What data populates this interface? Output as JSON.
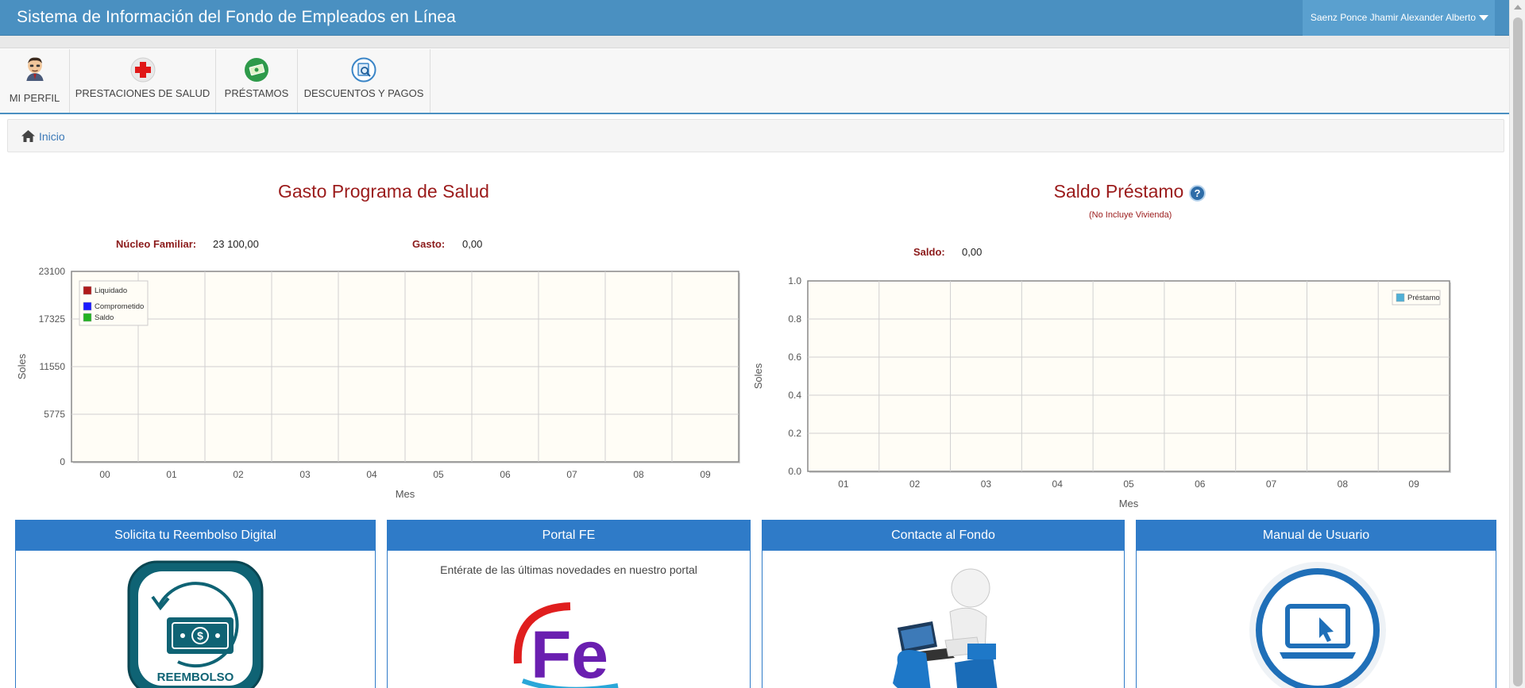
{
  "header": {
    "title": "Sistema de Información del Fondo de Empleados en Línea",
    "user_name": "Saenz Ponce Jhamir Alexander Alberto"
  },
  "modules": [
    {
      "label": "MI PERFIL",
      "icon": "user-avatar-icon"
    },
    {
      "label": "PRESTACIONES DE SALUD",
      "icon": "red-cross-icon"
    },
    {
      "label": "PRÉSTAMOS",
      "icon": "money-icon"
    },
    {
      "label": "DESCUENTOS Y PAGOS",
      "icon": "receipt-search-icon"
    }
  ],
  "breadcrumb": {
    "home_label": "Inicio"
  },
  "health": {
    "title": "Gasto Programa de Salud",
    "family_label": "Núcleo Familiar:",
    "family_value": "23 100,00",
    "spend_label": "Gasto:",
    "spend_value": "0,00"
  },
  "loan": {
    "title": "Saldo Préstamo",
    "subtitle": "(No Incluye Vivienda)",
    "balance_label": "Saldo:",
    "balance_value": "0,00"
  },
  "chart_data": [
    {
      "type": "bar",
      "ylabel": "Soles",
      "xlabel": "Mes",
      "ylim": [
        0,
        23100
      ],
      "yticks": [
        "0",
        "5775",
        "11550",
        "17325",
        "23100"
      ],
      "categories": [
        "00",
        "01",
        "02",
        "03",
        "04",
        "05",
        "06",
        "07",
        "08",
        "09"
      ],
      "grid": true,
      "legend_position": "top-left",
      "series": [
        {
          "name": "Liquidado",
          "color": "#b01a1a",
          "values": [
            0,
            0,
            0,
            0,
            0,
            0,
            0,
            0,
            0,
            0
          ]
        },
        {
          "name": "Comprometido",
          "color": "#1a1aff",
          "values": [
            0,
            0,
            0,
            0,
            0,
            0,
            0,
            0,
            0,
            0
          ]
        },
        {
          "name": "Saldo",
          "color": "#22b222",
          "values": [
            0,
            0,
            0,
            0,
            0,
            0,
            0,
            0,
            0,
            0
          ]
        }
      ]
    },
    {
      "type": "bar",
      "ylabel": "Soles",
      "xlabel": "Mes",
      "ylim": [
        0,
        1.0
      ],
      "yticks": [
        "0.0",
        "0.2",
        "0.4",
        "0.6",
        "0.8",
        "1.0"
      ],
      "categories": [
        "01",
        "02",
        "03",
        "04",
        "05",
        "06",
        "07",
        "08",
        "09"
      ],
      "grid": true,
      "legend_position": "top-right",
      "series": [
        {
          "name": "Préstamo",
          "color": "#4fb0d6",
          "values": [
            0,
            0,
            0,
            0,
            0,
            0,
            0,
            0,
            0
          ]
        }
      ]
    }
  ],
  "cards": [
    {
      "title": "Solicita tu Reembolso Digital",
      "image_text": "REEMBOLSO"
    },
    {
      "title": "Portal FE",
      "text": "Entérate de las últimas novedades en nuestro portal",
      "logo_text": "Fe"
    },
    {
      "title": "Contacte al Fondo"
    },
    {
      "title": "Manual de Usuario"
    }
  ],
  "colors": {
    "header_bg": "#4a90c1",
    "card_header": "#2f7bc8",
    "title_red": "#9b1b1b",
    "plot_bg": "#fffdf6"
  }
}
